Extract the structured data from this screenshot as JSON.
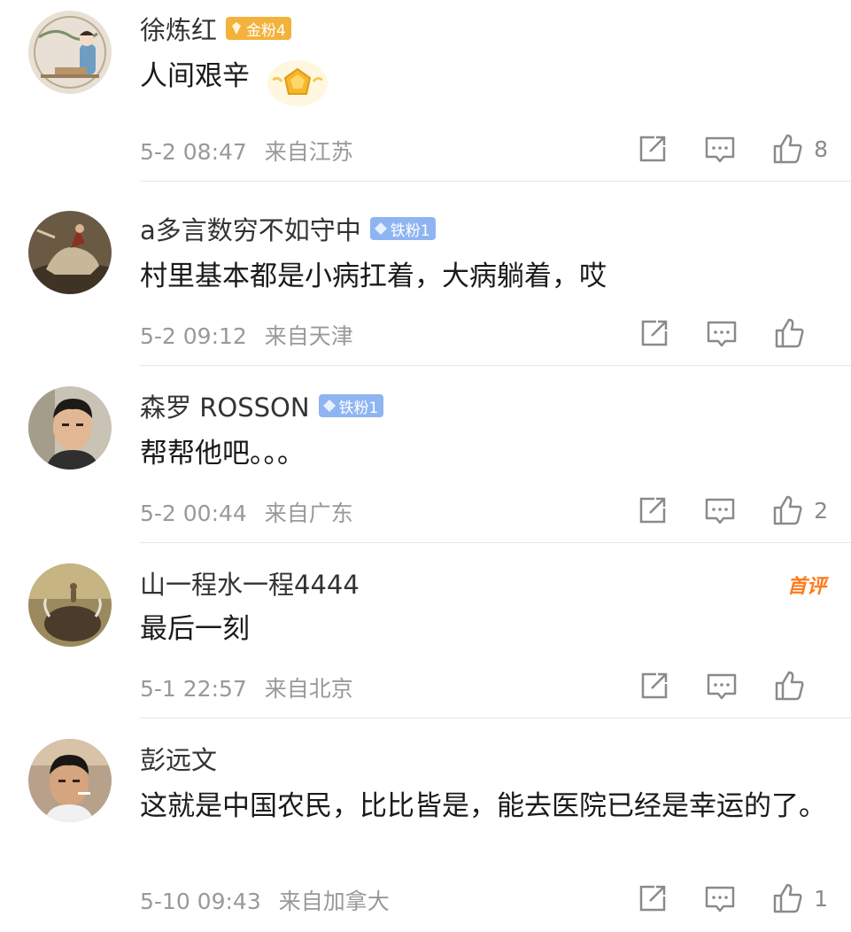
{
  "comments": [
    {
      "name": "徐炼红",
      "badge": "金粉4",
      "badge_type": "gold",
      "text": "人间艰辛",
      "date": "5-2 08:47",
      "location": "来自江苏",
      "likes": "8"
    },
    {
      "name": "a多言数穷不如守中",
      "badge": "铁粉1",
      "badge_type": "iron",
      "text": "村里基本都是小病扛着，大病躺着，哎",
      "date": "5-2 09:12",
      "location": "来自天津",
      "likes": ""
    },
    {
      "name": "森罗 ROSSON",
      "badge": "铁粉1",
      "badge_type": "iron",
      "text": "帮帮他吧。。。",
      "date": "5-2 00:44",
      "location": "来自广东",
      "likes": "2"
    },
    {
      "name": "山一程水一程4444",
      "tag": "首评",
      "text": "最后一刻",
      "date": "5-1 22:57",
      "location": "来自北京",
      "likes": ""
    },
    {
      "name": "彭远文",
      "text": "这就是中国农民，比比皆是，能去医院已经是幸运的了。",
      "date": "5-10 09:43",
      "location": "来自加拿大",
      "likes": "1"
    }
  ],
  "icons": {
    "share": "share-icon",
    "reply": "reply-icon",
    "like": "thumbs-up-icon"
  },
  "colors": {
    "gold_badge": "#f2b23b",
    "iron_badge": "#8fb4f2",
    "first_review": "#ff7a1a",
    "meta_text": "#999999"
  }
}
